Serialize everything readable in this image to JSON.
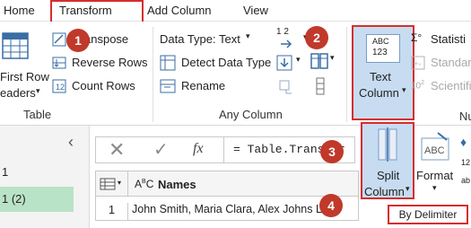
{
  "tabs": [
    {
      "label": "Home"
    },
    {
      "label": "Transform"
    },
    {
      "label": "Add Column"
    },
    {
      "label": "View"
    }
  ],
  "table_group": {
    "first_row_line1": "First Row",
    "first_row_line2": "eaders",
    "transpose": "anspose",
    "reverse_rows": "Reverse Rows",
    "count_rows": "Count Rows",
    "label": "Table"
  },
  "any_column_group": {
    "data_type": "Data Type: Text",
    "detect_data_type": "Detect Data Type",
    "rename": "Rename",
    "replace_values_nums": "1 2",
    "label": "Any Column"
  },
  "text_column": {
    "icon_text_1": "ABC",
    "icon_text_2": "123",
    "line1": "Text",
    "line2": "Column"
  },
  "number_group": {
    "statistics": "Statisti",
    "standard": "Standar",
    "scientific": "Scientifi",
    "scientific_prefix": "10",
    "scientific_exp": "2",
    "label": "Nu"
  },
  "split_column": {
    "line1": "Split",
    "line2": "Column"
  },
  "format": {
    "label": "Format",
    "icon_text": "ABC"
  },
  "right_edge": {
    "nums": "12",
    "ab": "ab"
  },
  "sidebar": {
    "items": [
      {
        "label": "1"
      },
      {
        "label": "1 (2)"
      }
    ]
  },
  "formula_bar": {
    "fx": "fx",
    "formula": "= Table.Transfor"
  },
  "grid": {
    "header": "Names",
    "type_badge_sup": "C",
    "type_badge_base": "B",
    "type_badge_a": "A",
    "rows": [
      {
        "num": "1",
        "value": "John Smith, Maria Clara, Alex Johns    L"
      }
    ]
  },
  "tooltip": {
    "label": "By Delimiter"
  },
  "badges": [
    "1",
    "2",
    "3",
    "4"
  ],
  "colors": {
    "badge": "#c0392b",
    "highlight_border": "#d62e2e",
    "selected_fill": "#c7dcf1",
    "selected_query": "#b9e3c6"
  }
}
